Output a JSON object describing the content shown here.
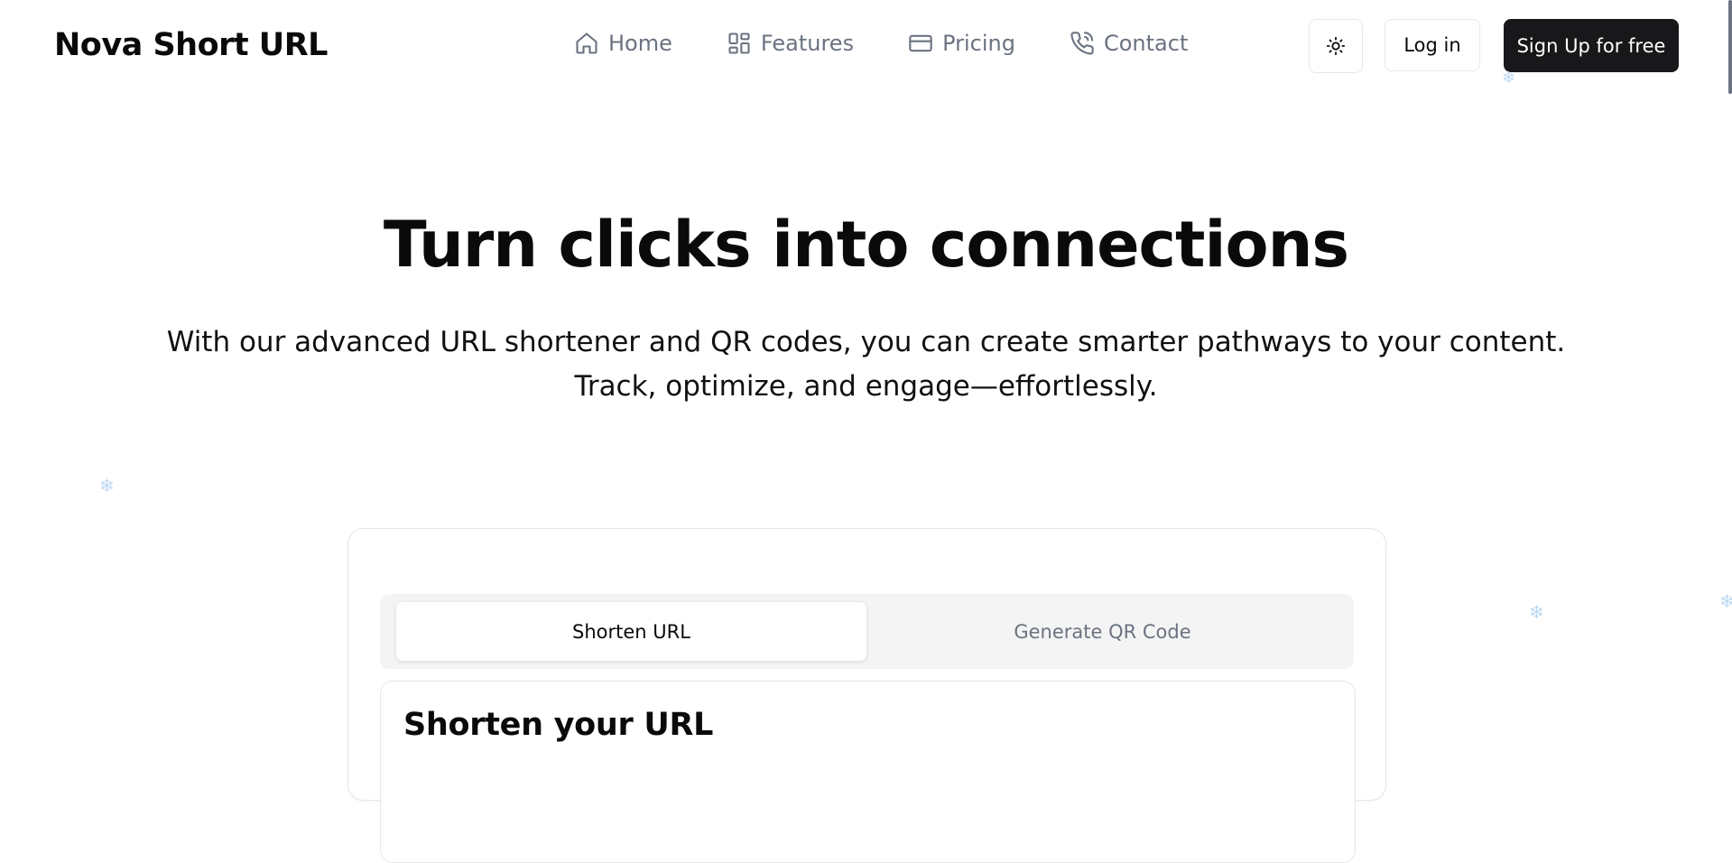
{
  "header": {
    "brand": "Nova Short URL",
    "nav": [
      {
        "label": "Home",
        "icon": "home-icon"
      },
      {
        "label": "Features",
        "icon": "grid-icon"
      },
      {
        "label": "Pricing",
        "icon": "credit-card-icon"
      },
      {
        "label": "Contact",
        "icon": "phone-icon"
      }
    ],
    "theme_toggle_icon": "sun-icon",
    "login_label": "Log in",
    "signup_label": "Sign Up for free"
  },
  "hero": {
    "title": "Turn clicks into connections",
    "subtitle_line1": "With our advanced URL shortener and QR codes, you can create smarter pathways to your content.",
    "subtitle_line2": "Track, optimize, and engage—effortlessly."
  },
  "card": {
    "tabs": [
      {
        "label": "Shorten URL",
        "active": true
      },
      {
        "label": "Generate QR Code",
        "active": false
      }
    ],
    "panel_title": "Shorten your URL"
  },
  "colors": {
    "primary_button": "#18181b",
    "muted_text": "#6b7280",
    "tab_background": "#f4f4f5",
    "snowflake": "#bcd8f2"
  }
}
